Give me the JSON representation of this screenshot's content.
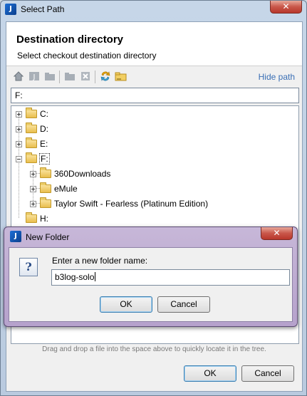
{
  "window": {
    "title": "Select Path",
    "app_icon": "intellij-icon",
    "close_symbol": "✕"
  },
  "header": {
    "title": "Destination directory",
    "subtitle": "Select checkout destination directory"
  },
  "toolbar": {
    "icons": [
      "home-icon",
      "project-icon",
      "module-icon",
      "new-folder-icon",
      "delete-icon",
      "refresh-icon",
      "show-hidden-icon"
    ],
    "hide_path_label": "Hide path"
  },
  "path_field": {
    "value": "F:"
  },
  "tree": {
    "nodes": [
      {
        "label": "C:",
        "expanded": false
      },
      {
        "label": "D:",
        "expanded": false
      },
      {
        "label": "E:",
        "expanded": false
      },
      {
        "label": "F:",
        "expanded": true,
        "selected": true
      },
      {
        "label": "360Downloads",
        "expanded": false,
        "parent": "F:"
      },
      {
        "label": "eMule",
        "expanded": false,
        "parent": "F:"
      },
      {
        "label": "Taylor Swift - Fearless (Platinum Edition)",
        "expanded": false,
        "parent": "F:"
      },
      {
        "label": "H:",
        "expanded": false
      }
    ]
  },
  "hint": "Drag and drop a file into the space above to quickly locate it in the tree.",
  "buttons": {
    "ok": "OK",
    "cancel": "Cancel"
  },
  "modal": {
    "title": "New Folder",
    "icon": "question-icon",
    "icon_glyph": "?",
    "prompt": "Enter a new folder name:",
    "input_value": "b3log-solo",
    "ok": "OK",
    "cancel": "Cancel"
  },
  "colors": {
    "link": "#3a6fb5",
    "modal_frame": "#b6a2cc",
    "window_frame": "#b9cadf"
  }
}
